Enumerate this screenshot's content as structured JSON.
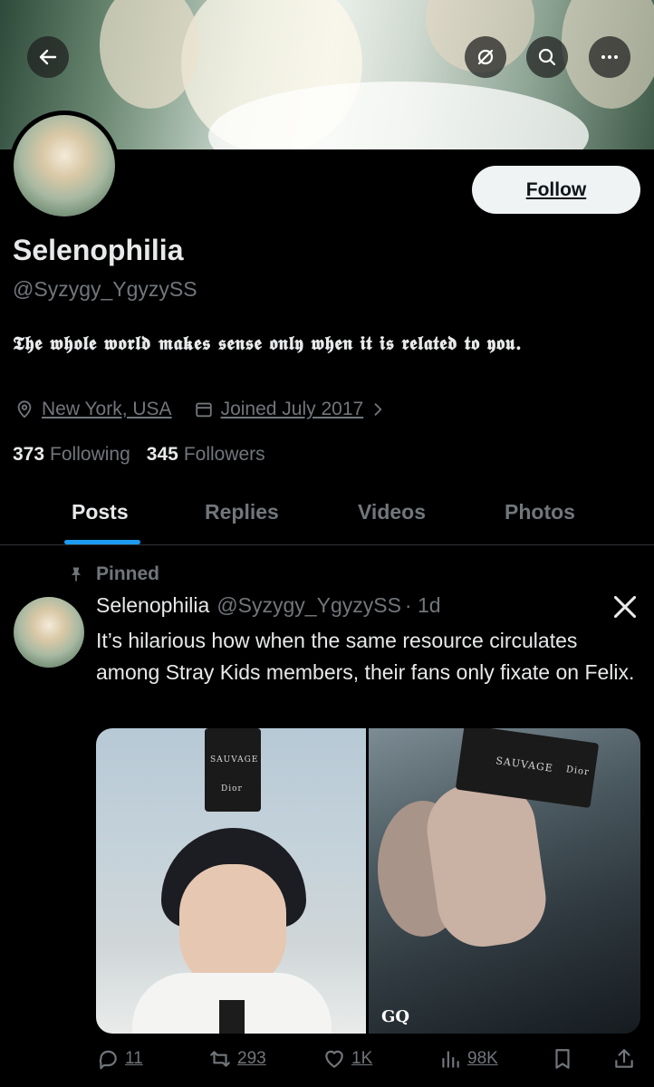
{
  "header": {
    "back_icon": "arrow-left-icon",
    "mute_icon": "circle-slash-icon",
    "search_icon": "search-icon",
    "more_icon": "more-horizontal-icon"
  },
  "profile": {
    "follow_label": "Follow",
    "display_name": "Selenophilia",
    "handle": "@Syzygy_YgyzySS",
    "bio": "𝕿𝖍𝖊 𝖜𝖍𝖔𝖑𝖊 𝖜𝖔𝖗𝖑𝖉 𝖒𝖆𝖐𝖊𝖘 𝖘𝖊𝖓𝖘𝖊 𝖔𝖓𝖑𝖞 𝖜𝖍𝖊𝖓 𝖎𝖙 𝖎𝖘 𝖗𝖊𝖑𝖆𝖙𝖊𝖉 𝖙𝖔 𝖞𝖔𝖚.",
    "location": "New York, USA",
    "joined": "Joined July 2017",
    "following_count": "373",
    "following_label": "Following",
    "followers_count": "345",
    "followers_label": "Followers"
  },
  "tabs": [
    "Posts",
    "Replies",
    "Videos",
    "Photos"
  ],
  "active_tab": "Posts",
  "tweet": {
    "pinned_label": "Pinned",
    "author_name": "Selenophilia",
    "author_handle": "@Syzygy_YgyzySS",
    "time": "· 1d",
    "text": "It’s hilarious how when the same resource circulates among Stray Kids members, their fans only fixate on Felix.",
    "media_label_1": "SAUVAGE",
    "media_brand_1": "Dior",
    "media_label_2": "SAUVAGE",
    "media_brand_2": "Dior",
    "magazine_logo": "GQ",
    "replies": "11",
    "retweets": "293",
    "likes": "1K",
    "views": "98K"
  },
  "colors": {
    "background": "#000000",
    "text_primary": "#e7e9ea",
    "text_secondary": "#71767b",
    "accent": "#1d9bf0",
    "follow_button_bg": "#eff3f4"
  }
}
